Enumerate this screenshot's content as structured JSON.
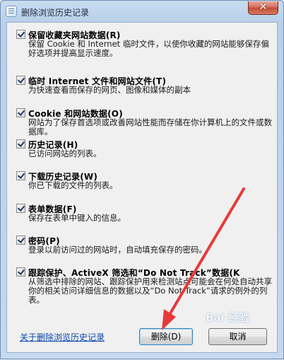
{
  "window": {
    "title": "删除浏览历史记录",
    "close_label": "✕"
  },
  "options": [
    {
      "title": "保留收藏夹网站数据(R)",
      "desc": "保留 Cookie 和 Internet 临时文件，以使你收藏的网站能够保存偏好选项并提高显示速度。",
      "checked": true
    },
    {
      "title": "临时 Internet 文件和网站文件(T)",
      "desc": "为快速查看而保存的网页、图像和媒体的副本",
      "checked": true
    },
    {
      "title": "Cookie 和网站数据(O)",
      "desc": "网站为了保存首选项或改善网站性能而存储在你计算机上的文件或数据库。",
      "checked": true
    },
    {
      "title": "历史记录(H)",
      "desc": "已访问网站的列表。",
      "checked": true
    },
    {
      "title": "下载历史记录(W)",
      "desc": "你已下载的文件的列表。",
      "checked": true
    },
    {
      "title": "表单数据(F)",
      "desc": "保存在表单中键入的信息。",
      "checked": true
    },
    {
      "title": "密码(P)",
      "desc": "登录以前访问过的网站时，自动填充保存的密码。",
      "checked": true
    },
    {
      "title": "跟踪保护、ActiveX 筛选和“Do Not Track”数据(K",
      "desc": "从筛选中排除的网站、跟踪保护用来检测站点可能会在何处自动共享你的相关访问详细信息的数据以及“Do Not Track”请求的例外的列表。",
      "checked": true
    }
  ],
  "footer": {
    "link_text": "关于删除浏览历史记录",
    "delete_label": "删除(D)",
    "cancel_label": "取消"
  },
  "overlay": {
    "watermark": "Bai 经验"
  },
  "colors": {
    "arrow": "#e8393a",
    "link": "#0645ad"
  }
}
